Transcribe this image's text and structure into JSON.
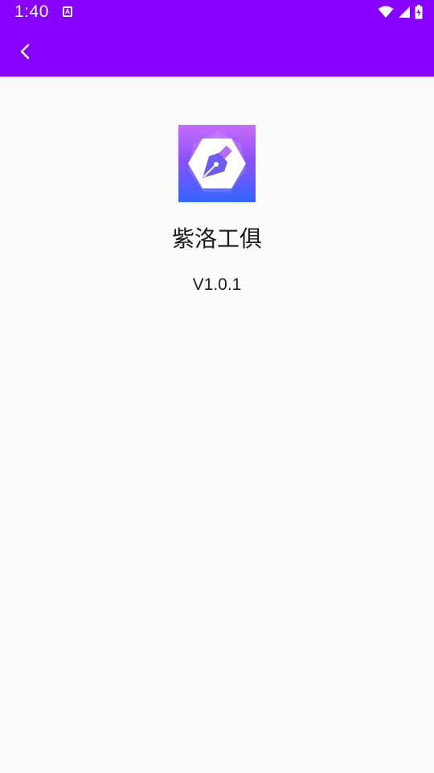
{
  "status_bar": {
    "time": "1:40",
    "notification_icon_letter": "A",
    "icons": [
      "wifi-icon",
      "signal-icon",
      "battery-icon"
    ]
  },
  "toolbar": {
    "back_icon": "chevron-left-icon",
    "background_color": "#8800ff"
  },
  "about": {
    "app_icon": "fountain-pen-icon",
    "app_name": "紫洛工俱",
    "version": "V1.0.1"
  }
}
